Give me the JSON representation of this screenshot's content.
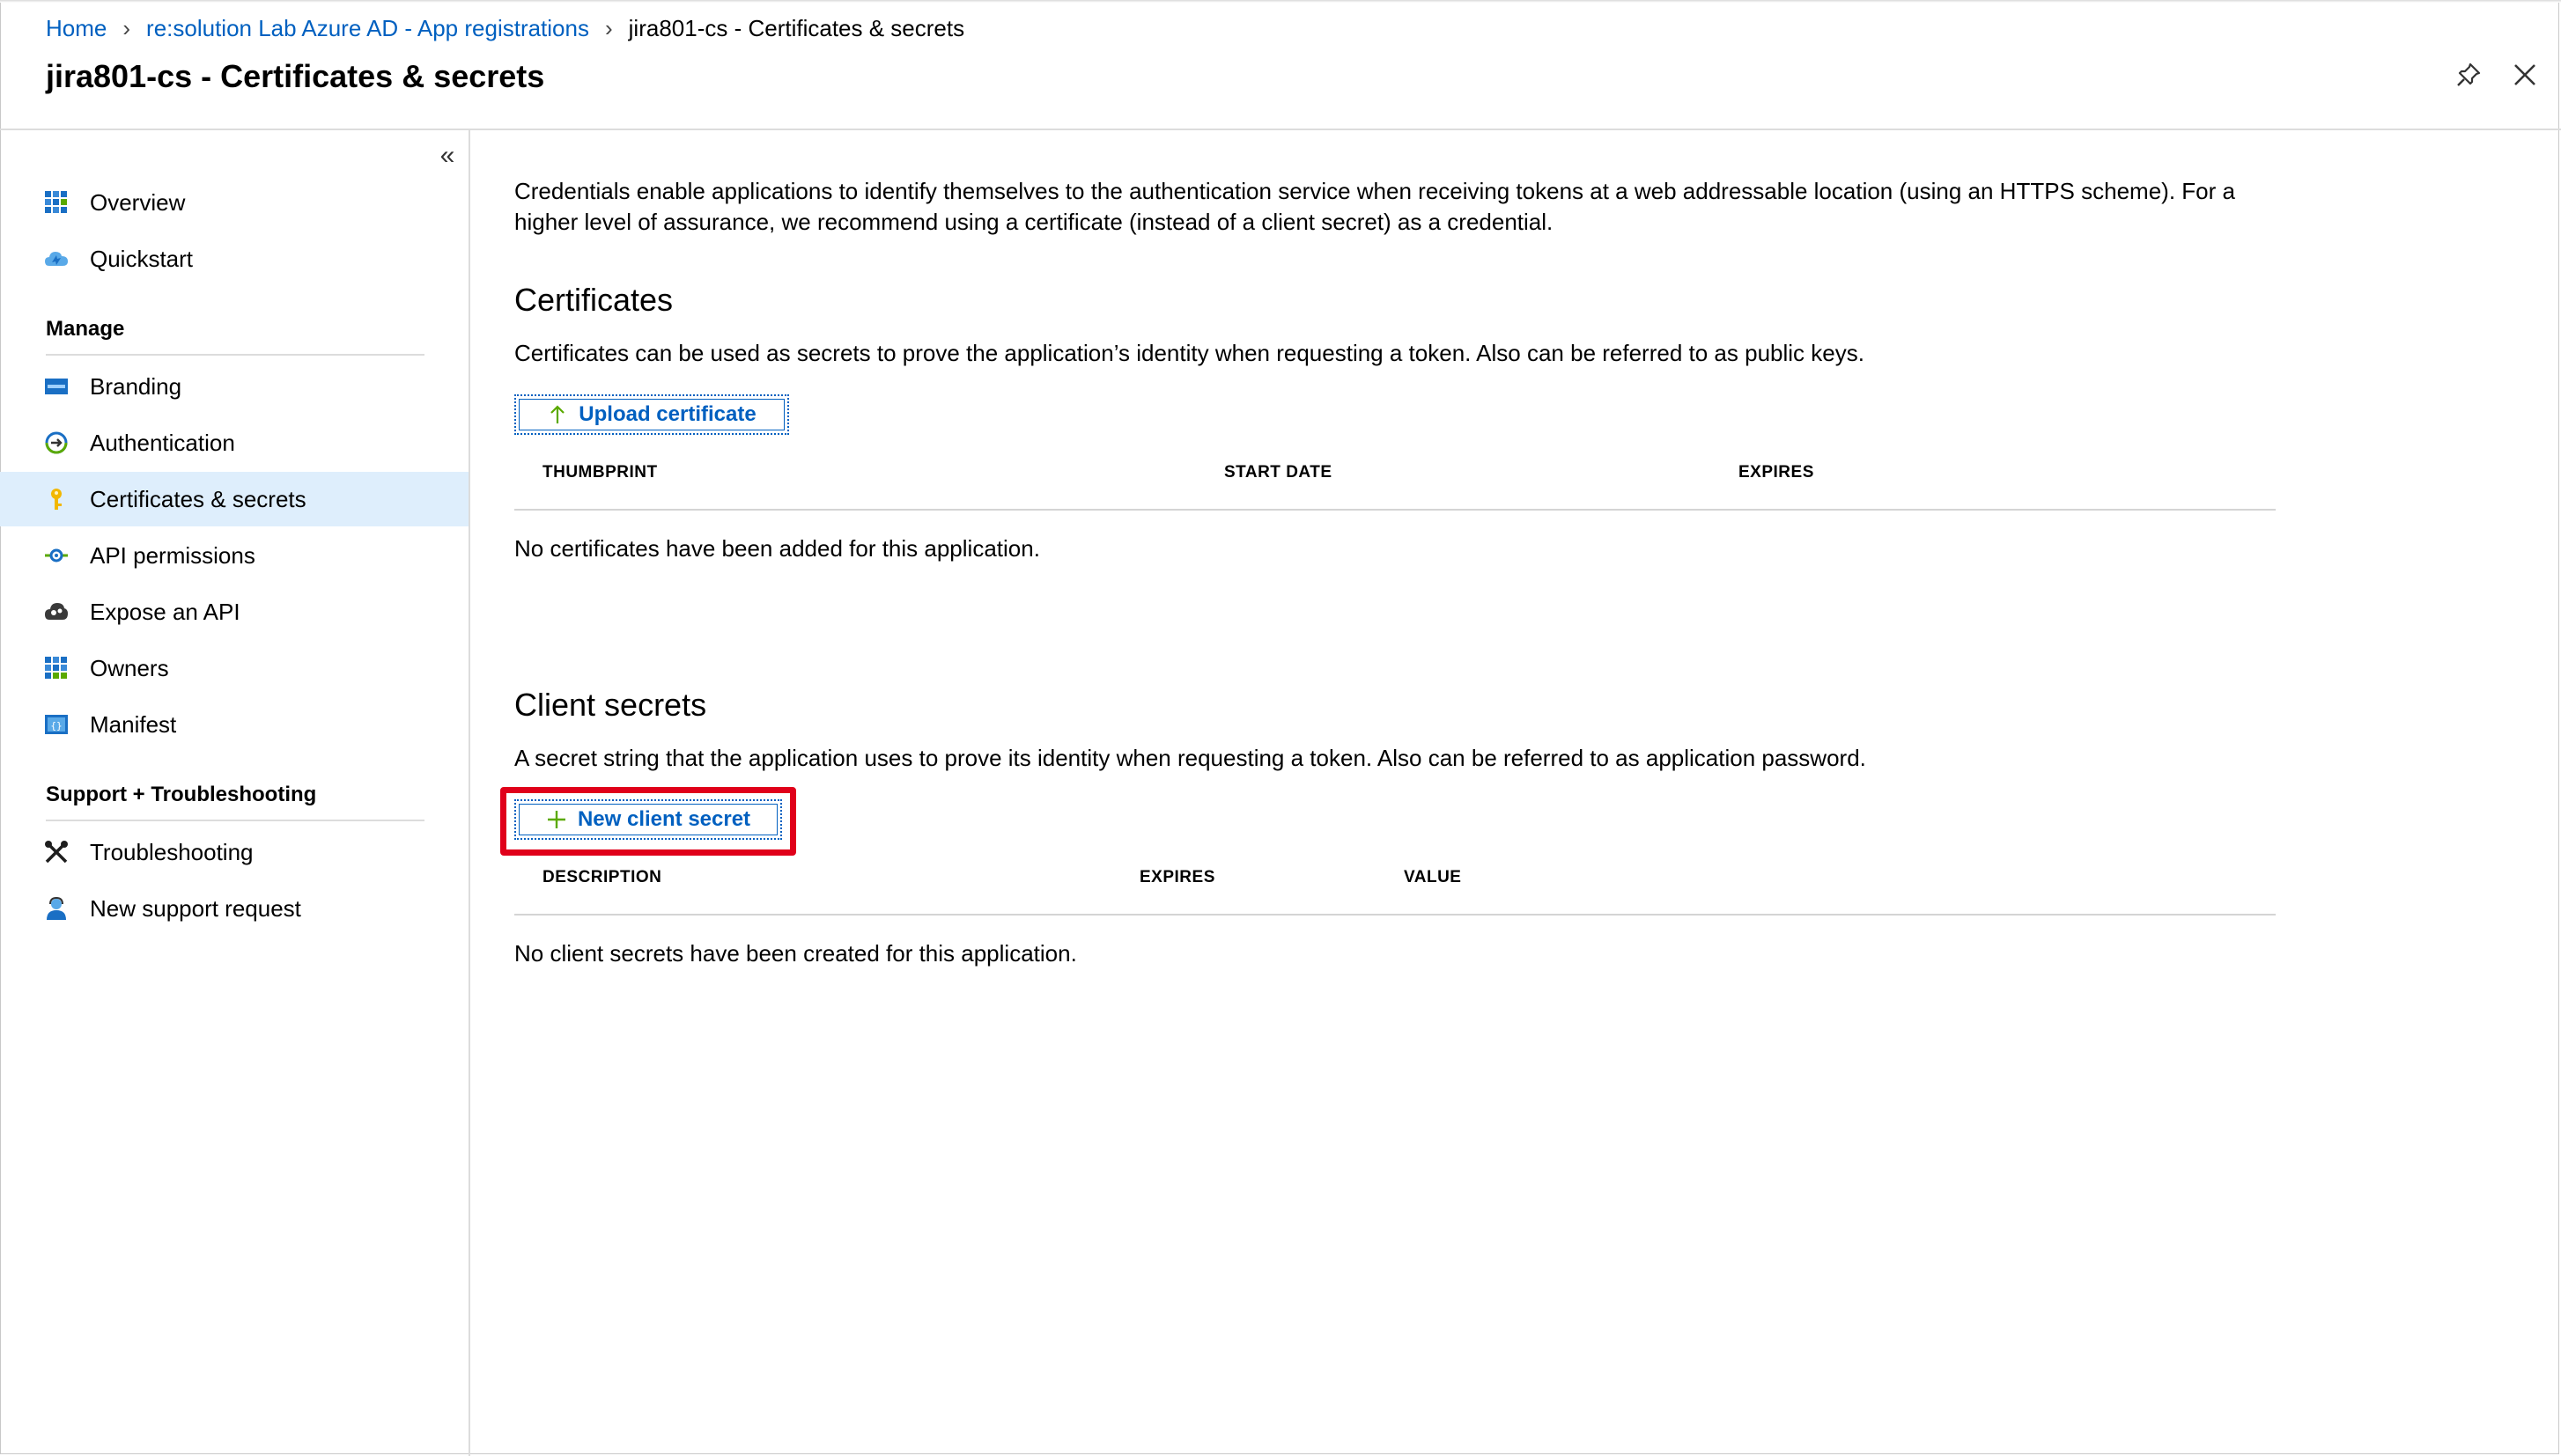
{
  "breadcrumb": {
    "home": "Home",
    "registrations": "re:solution Lab Azure AD - App registrations",
    "current": "jira801-cs - Certificates & secrets"
  },
  "page": {
    "title": "jira801-cs - Certificates & secrets"
  },
  "sidebar": {
    "collapse_glyph": "«",
    "top_items": [
      {
        "label": "Overview",
        "icon": "overview-grid-icon"
      },
      {
        "label": "Quickstart",
        "icon": "quickstart-cloud-icon"
      }
    ],
    "manage_heading": "Manage",
    "manage_items": [
      {
        "label": "Branding",
        "icon": "branding-icon"
      },
      {
        "label": "Authentication",
        "icon": "authentication-icon"
      },
      {
        "label": "Certificates & secrets",
        "icon": "key-icon",
        "active": true
      },
      {
        "label": "API permissions",
        "icon": "api-permissions-icon"
      },
      {
        "label": "Expose an API",
        "icon": "expose-api-cloud-icon"
      },
      {
        "label": "Owners",
        "icon": "owners-grid-icon"
      },
      {
        "label": "Manifest",
        "icon": "manifest-icon"
      }
    ],
    "support_heading": "Support + Troubleshooting",
    "support_items": [
      {
        "label": "Troubleshooting",
        "icon": "tools-icon"
      },
      {
        "label": "New support request",
        "icon": "support-person-icon"
      }
    ]
  },
  "main": {
    "intro": "Credentials enable applications to identify themselves to the authentication service when receiving tokens at a web addressable location (using an HTTPS scheme). For a higher level of assurance, we recommend using a certificate (instead of a client secret) as a credential.",
    "certificates": {
      "heading": "Certificates",
      "description": "Certificates can be used as secrets to prove the application’s identity when requesting a token. Also can be referred to as public keys.",
      "button_label": "Upload certificate",
      "columns": [
        "THUMBPRINT",
        "START DATE",
        "EXPIRES"
      ],
      "empty_text": "No certificates have been added for this application."
    },
    "client_secrets": {
      "heading": "Client secrets",
      "description": "A secret string that the application uses to prove its identity when requesting a token. Also can be referred to as application password.",
      "button_label": "New client secret",
      "columns": [
        "DESCRIPTION",
        "EXPIRES",
        "VALUE"
      ],
      "empty_text": "No client secrets have been created for this application."
    }
  },
  "colors": {
    "link": "#0060c0",
    "active_nav": "#deeefc",
    "highlight": "#e0001a",
    "button_icon_green": "#5aa900"
  }
}
